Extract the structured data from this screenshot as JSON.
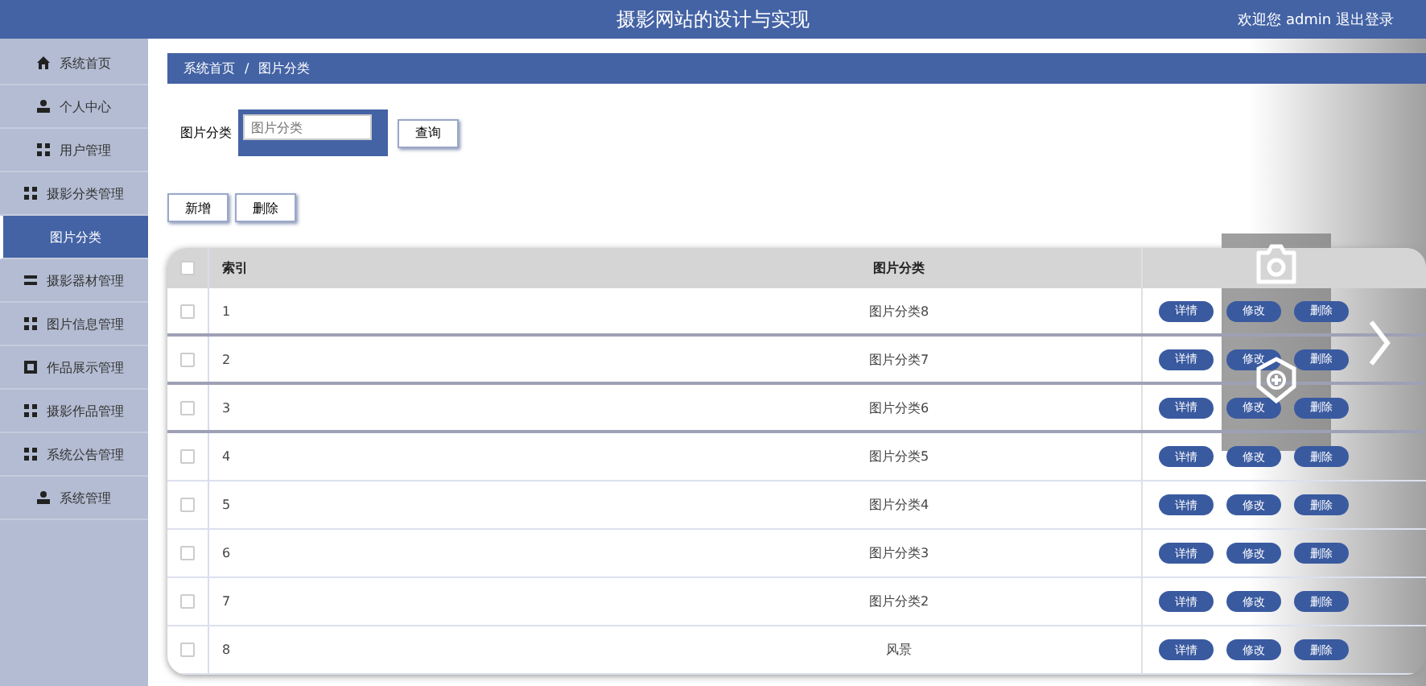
{
  "header": {
    "title": "摄影网站的设计与实现",
    "user_text": "欢迎您 admin 退出登录"
  },
  "sidebar": {
    "items": [
      {
        "label": "系统首页",
        "kind": "home",
        "selected": false
      },
      {
        "label": "个人中心",
        "kind": "person",
        "selected": false
      },
      {
        "label": "用户管理",
        "kind": "grid",
        "selected": false
      },
      {
        "label": "摄影分类管理",
        "kind": "grid",
        "selected": false
      },
      {
        "label": "图片分类",
        "kind": "plain",
        "selected": true
      },
      {
        "label": "摄影器材管理",
        "kind": "list",
        "selected": false
      },
      {
        "label": "图片信息管理",
        "kind": "grid",
        "selected": false
      },
      {
        "label": "作品展示管理",
        "kind": "square",
        "selected": false
      },
      {
        "label": "摄影作品管理",
        "kind": "grid",
        "selected": false
      },
      {
        "label": "系统公告管理",
        "kind": "grid",
        "selected": false
      },
      {
        "label": "系统管理",
        "kind": "person",
        "selected": false
      }
    ]
  },
  "breadcrumb": [
    "系统首页",
    "图片分类"
  ],
  "breadcrumb_separator": "/",
  "search": {
    "label": "图片分类",
    "placeholder": "图片分类",
    "button": "查询"
  },
  "actions": [
    "新增",
    "删除"
  ],
  "table": {
    "columns": [
      "索引",
      "图片分类"
    ],
    "all_checked": false,
    "rows": [
      {
        "index": "1",
        "name": "图片分类8",
        "checked": false,
        "buttons": [
          "详情",
          "修改",
          "删除"
        ]
      },
      {
        "index": "2",
        "name": "图片分类7",
        "checked": false,
        "buttons": [
          "详情",
          "修改",
          "删除"
        ]
      },
      {
        "index": "3",
        "name": "图片分类6",
        "checked": false,
        "buttons": [
          "详情",
          "修改",
          "删除"
        ]
      },
      {
        "index": "4",
        "name": "图片分类5",
        "checked": false,
        "buttons": [
          "详情",
          "修改",
          "删除"
        ]
      },
      {
        "index": "5",
        "name": "图片分类4",
        "checked": false,
        "buttons": [
          "详情",
          "修改",
          "删除"
        ]
      },
      {
        "index": "6",
        "name": "图片分类3",
        "checked": false,
        "buttons": [
          "详情",
          "修改",
          "删除"
        ]
      },
      {
        "index": "7",
        "name": "图片分类2",
        "checked": false,
        "buttons": [
          "详情",
          "修改",
          "删除"
        ]
      },
      {
        "index": "8",
        "name": "风景",
        "checked": false,
        "buttons": [
          "详情",
          "修改",
          "删除"
        ]
      }
    ]
  }
}
